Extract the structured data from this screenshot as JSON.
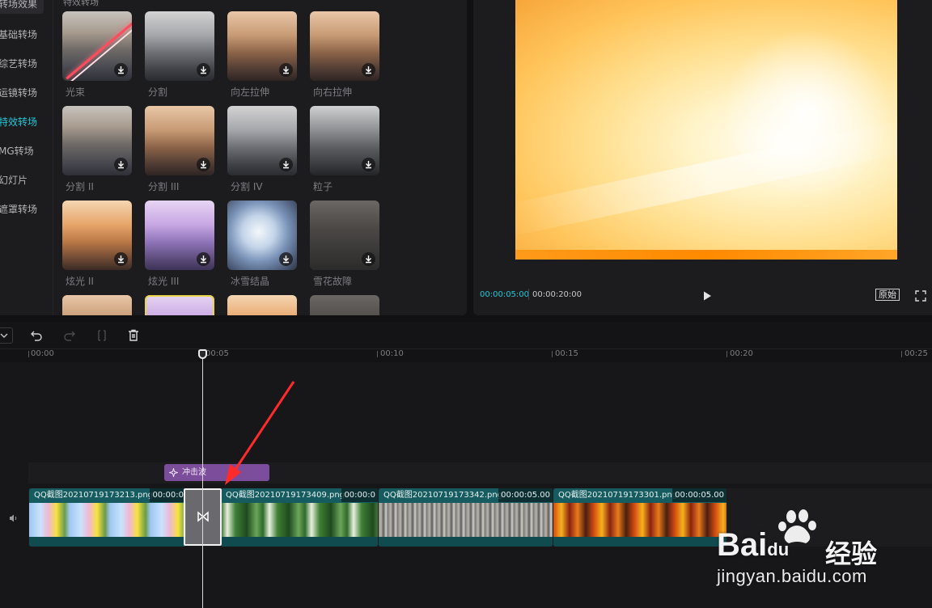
{
  "categories": [
    {
      "label": "转场效果",
      "state": "selected"
    },
    {
      "label": "基础转场",
      "state": ""
    },
    {
      "label": "综艺转场",
      "state": ""
    },
    {
      "label": "运镜转场",
      "state": ""
    },
    {
      "label": "特效转场",
      "state": "active"
    },
    {
      "label": "MG转场",
      "state": ""
    },
    {
      "label": "幻灯片",
      "state": ""
    },
    {
      "label": "遮罩转场",
      "state": ""
    }
  ],
  "grid": {
    "title": "特效转场",
    "items": [
      {
        "label": "光束",
        "style": "street"
      },
      {
        "label": "分割",
        "style": "gray"
      },
      {
        "label": "向左拉伸",
        "style": "warm"
      },
      {
        "label": "向右拉伸",
        "style": "warm"
      },
      {
        "label": "分割 II",
        "style": "street"
      },
      {
        "label": "分割 III",
        "style": "warm"
      },
      {
        "label": "分割 IV",
        "style": "gray"
      },
      {
        "label": "粒子",
        "style": "noise"
      },
      {
        "label": "炫光 II",
        "style": "orange"
      },
      {
        "label": "炫光 III",
        "style": "purple"
      },
      {
        "label": "冰雪结晶",
        "style": "ice"
      },
      {
        "label": "雪花故障",
        "style": "dark"
      },
      {
        "label": "",
        "style": "warm"
      },
      {
        "label": "",
        "style": "purple"
      },
      {
        "label": "",
        "style": "orange"
      },
      {
        "label": "",
        "style": "dark"
      }
    ]
  },
  "preview": {
    "current_time": "00:00:05:00",
    "total_time": "00:00:20:00",
    "ratio_label": "原始"
  },
  "ruler": {
    "labels": [
      "00:00",
      "00:05",
      "00:10",
      "00:15",
      "00:20",
      "00:25"
    ]
  },
  "effect_clip": {
    "label": "冲击波"
  },
  "clips": [
    {
      "name": "QQ截图20210719173213.png",
      "duration": "00:00:0",
      "frames": "pika"
    },
    {
      "name": "QQ截图20210719173409.png",
      "duration": "00:00:0",
      "frames": "leaf"
    },
    {
      "name": "QQ截图20210719173342.png",
      "duration": "00:00:05.00",
      "frames": "crowd"
    },
    {
      "name": "QQ截图20210719173301.png",
      "duration": "00:00:05.00",
      "frames": "flower"
    }
  ],
  "watermark": {
    "brand": "Bai",
    "brand_mid": "du",
    "brand_cn": "经验",
    "url": "jingyan.baidu.com"
  },
  "colors": {
    "accent": "#22c6d6",
    "clip": "#155b5f",
    "effect": "#7b4d9a"
  }
}
